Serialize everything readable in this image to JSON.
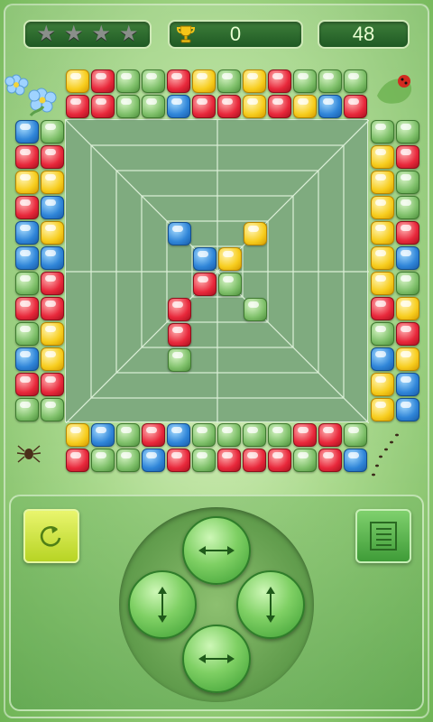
{
  "hud": {
    "stars_total": 4,
    "stars_earned": 0,
    "score": "0",
    "moves": "48"
  },
  "colors": {
    "blue": "#2f85d8",
    "red": "#e8283b",
    "green": "#7fc06a",
    "yellow": "#f7cd1e"
  },
  "board": {
    "top_rows": [
      [
        "yellow",
        "red",
        "green",
        "green",
        "red",
        "yellow",
        "green",
        "yellow",
        "red",
        "green",
        "green",
        "green"
      ],
      [
        "red",
        "red",
        "green",
        "green",
        "blue",
        "red",
        "red",
        "yellow",
        "red",
        "yellow",
        "blue",
        "red"
      ]
    ],
    "bottom_rows": [
      [
        "yellow",
        "blue",
        "green",
        "red",
        "blue",
        "green",
        "green",
        "green",
        "green",
        "red",
        "red",
        "green"
      ],
      [
        "red",
        "green",
        "green",
        "blue",
        "red",
        "green",
        "red",
        "red",
        "red",
        "green",
        "red",
        "blue"
      ]
    ],
    "left_cols": [
      [
        "blue",
        "red",
        "yellow",
        "red",
        "blue",
        "blue",
        "green",
        "red",
        "green",
        "blue",
        "red",
        "green"
      ],
      [
        "green",
        "red",
        "yellow",
        "blue",
        "yellow",
        "blue",
        "red",
        "red",
        "yellow",
        "yellow",
        "red",
        "green"
      ]
    ],
    "right_cols": [
      [
        "green",
        "yellow",
        "yellow",
        "yellow",
        "yellow",
        "yellow",
        "yellow",
        "red",
        "green",
        "blue",
        "yellow",
        "yellow"
      ],
      [
        "green",
        "red",
        "green",
        "green",
        "red",
        "blue",
        "green",
        "yellow",
        "red",
        "yellow",
        "blue",
        "blue"
      ]
    ],
    "field_tiles": [
      {
        "row": 4,
        "col": 4,
        "color": "blue"
      },
      {
        "row": 4,
        "col": 7,
        "color": "yellow"
      },
      {
        "row": 5,
        "col": 5,
        "color": "blue"
      },
      {
        "row": 5,
        "col": 6,
        "color": "yellow"
      },
      {
        "row": 6,
        "col": 5,
        "color": "red"
      },
      {
        "row": 6,
        "col": 6,
        "color": "green"
      },
      {
        "row": 7,
        "col": 4,
        "color": "red"
      },
      {
        "row": 7,
        "col": 7,
        "color": "green"
      },
      {
        "row": 8,
        "col": 4,
        "color": "red"
      },
      {
        "row": 9,
        "col": 4,
        "color": "green"
      }
    ],
    "grid_size": 12
  },
  "controls": {
    "restart": "restart-icon",
    "menu": "list-icon",
    "dpad_top": "horizontal-arrows-icon",
    "dpad_left": "vertical-arrows-icon",
    "dpad_right": "vertical-arrows-icon",
    "dpad_bottom": "horizontal-arrows-icon"
  }
}
